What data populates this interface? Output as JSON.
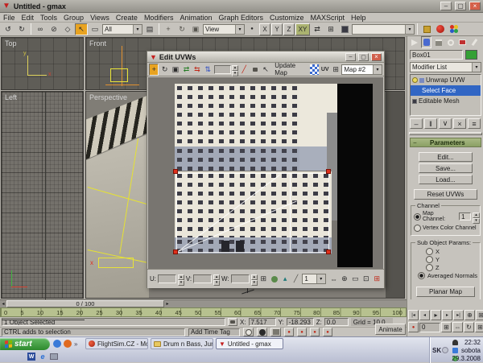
{
  "window": {
    "title": "Untitled - gmax"
  },
  "menu": {
    "items": [
      "File",
      "Edit",
      "Tools",
      "Group",
      "Views",
      "Create",
      "Modifiers",
      "Animation",
      "Graph Editors",
      "Customize",
      "MAXScript",
      "Help"
    ]
  },
  "main_toolbar": {
    "selection_filter_value": "All",
    "coordinate_system_value": "View",
    "x_label": "X",
    "y_label": "Y",
    "z_label": "Z",
    "xy_label": "XY"
  },
  "viewports": {
    "top_label": "Top",
    "front_label": "Front",
    "left_label": "Left",
    "perspective_label": "Perspective"
  },
  "uvw_dialog": {
    "title": "Edit UVWs",
    "update_map_label": "Update Map",
    "map_dropdown_value": "Map #2",
    "u_label": "U:",
    "v_label": "V:",
    "w_label": "W:",
    "selection_mode_value": "1"
  },
  "command_panel": {
    "object_name": "Box01",
    "modifier_list_label": "Modifier List",
    "stack": [
      "Unwrap UVW",
      "Select Face",
      "Editable Mesh"
    ],
    "parameters_label": "Parameters",
    "edit_label": "Edit...",
    "save_label": "Save...",
    "load_label": "Load...",
    "reset_label": "Reset UVWs",
    "channel_group_label": "Channel",
    "map_channel_label": "Map Channel:",
    "map_channel_value": "1",
    "vertex_color_label": "Vertex Color Channel",
    "sub_object_group_label": "Sub Object Params:",
    "x_label": "X",
    "y_label": "Y",
    "z_label": "Z",
    "averaged_normals_label": "Averaged Normals",
    "planar_map_label": "Planar Map"
  },
  "timeline": {
    "slider_label": "0 / 100",
    "ticks": [
      "0",
      "5",
      "10",
      "15",
      "20",
      "25",
      "30",
      "35",
      "40",
      "45",
      "50",
      "55",
      "60",
      "65",
      "70",
      "75",
      "80",
      "85",
      "90",
      "95",
      "100"
    ]
  },
  "status_bar": {
    "selection_text": "1 Object Selected",
    "prompt_text": "CTRL adds to selection",
    "x_label": "X:",
    "x_value": "7.517",
    "y_label": "Y:",
    "y_value": "-18.293",
    "z_label": "Z:",
    "z_value": "0.0",
    "grid_text": "Grid = 10.0",
    "animate_label": "Animate",
    "add_time_tag_label": "Add Time Tag",
    "key_field_value": "0"
  },
  "taskbar": {
    "start_label": "start",
    "tasks": [
      "FlightSim.CZ - Mozilla ...",
      "Drum n Bass, Jungle",
      "Untitled - gmax"
    ],
    "tray": {
      "lang": "SK",
      "time": "22:32",
      "day": "sobota",
      "date": "29.3.2008"
    }
  },
  "icons": {
    "undo": "↺",
    "redo": "↻",
    "link": "∞",
    "unlink": "⊘",
    "bind": "◇",
    "select_arrow": "↖",
    "region": "▭",
    "by_name": "▤",
    "move": "+",
    "rotate": "↻",
    "scale": "▣",
    "mirror": "⇄",
    "flip_h": "⇆",
    "flip_v": "⇅",
    "dropdown": "▾",
    "spin_up": "▴",
    "spin_down": "▾",
    "minimize": "–",
    "maximize": "▢",
    "close": "×",
    "play_start": "|◂",
    "prev": "◂",
    "play": "▸",
    "next": "▸",
    "play_end": "▸|",
    "zoom": "⊕",
    "zoom_all": "⊞",
    "zoom_extents": "⊡",
    "zoom_region": "▭",
    "pan": "⇔",
    "arc_rotate": "↻",
    "min_max_toggle": "⊞",
    "pick": "↖",
    "options": "⊞",
    "overflow": "»",
    "key": "●",
    "brush": "╱"
  },
  "colors": {
    "selection_blue": "#3166c4",
    "rollout_green": "#97a873",
    "start_green": "#3f9e3f",
    "handle_red": "#e0301c",
    "object_color_swatch": "#35a035"
  }
}
